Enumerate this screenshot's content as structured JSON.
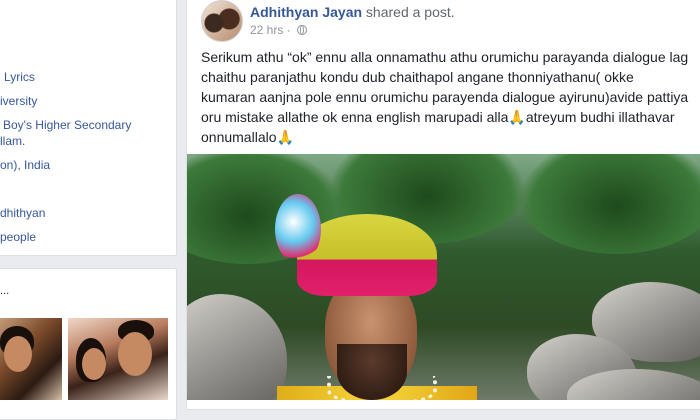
{
  "intro": {
    "items": [
      "Lyrics",
      "iversity",
      "Boy's Higher Secondary",
      "llam.",
      "on), India",
      "dhithyan",
      "people"
    ]
  },
  "photos": {
    "dots": "..."
  },
  "post": {
    "author": "Adhithyan Jayan",
    "action": "shared a post.",
    "time": "22 hrs",
    "time_separator": "·",
    "text_lines": [
      "Serikum athu “ok” ennu alla onnamathu athu orumichu parayanda dialogue lag",
      "chaithu paranjathu kondu dub chaithapol angane thonniyathanu( okke",
      "kumaran aanjna pole ennu orumichu parayenda dialogue ayirunu)avide pattiya",
      "oru mistake allathe ok enna english marupadi alla",
      "atreyum budhi illathavar",
      "onnumallalo"
    ],
    "pray_emoji": "🙏"
  },
  "icons": {
    "privacy": "globe-icon"
  },
  "colors": {
    "link": "#365899",
    "meta": "#90949c",
    "background": "#e9ebee"
  }
}
